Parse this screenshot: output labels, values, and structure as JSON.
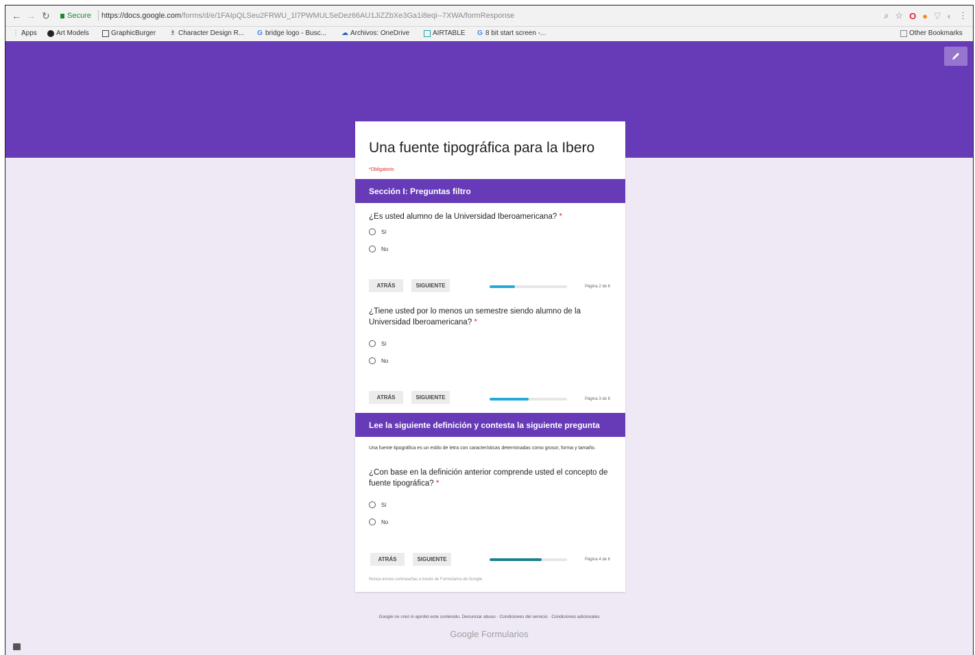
{
  "browser": {
    "secure_label": "Secure",
    "url_host": "https://docs.google.com",
    "url_path": "/forms/d/e/1FAIpQLSeu2FRWU_1l7PWMULSeDez66AU1JiZZbXe3Ga1i8eqi--7XWA/formResponse",
    "bookmarks": [
      "Apps",
      "Art Models",
      "GraphicBurger",
      "Character Design R...",
      "bridge logo - Busc...",
      "Archivos: OneDrive",
      "AIRTABLE",
      "8 bit start screen -...",
      "Other Bookmarks"
    ]
  },
  "form": {
    "title": "Una fuente tipográfica para la Ibero",
    "required_note": "*Obligatorio",
    "sections": [
      {
        "header": "Sección I: Preguntas filtro",
        "question": "¿Es usted alumno de la Universidad Iberoamericana?",
        "options": [
          "Sí",
          "No"
        ],
        "back": "ATRÁS",
        "next": "SIGUIENTE",
        "progress": 0.33,
        "page_text": "Página 2 de 6"
      },
      {
        "question": "¿Tiene usted por lo menos un semestre siendo alumno de la Universidad Iberoamericana?",
        "options": [
          "Sí",
          "No"
        ],
        "back": "ATRÁS",
        "next": "SIGUIENTE",
        "progress": 0.5,
        "page_text": "Página 3 de 6"
      },
      {
        "header": "Lee la siguiente definición y contesta la siguiente pregunta",
        "description": "Una fuente tipográfica es un estilo de letra con características determinadas como grosor, forma y tamaño.",
        "question": "¿Con base en la definición anterior comprende usted el concepto de fuente tipográfica?",
        "options": [
          "Sí",
          "No"
        ],
        "back": "ATRÁS",
        "next": "SIGUIENTE",
        "progress": 0.67,
        "page_text": "Página 4 de 6",
        "never_submit": "Nunca envíes contraseñas a través de Formularios de Google."
      }
    ],
    "footer_links": "Google no creó ni aprobó este contenido. Denunciar abuso · Condiciones del servicio · Condiciones adicionales",
    "brand": "Google Formularios"
  },
  "colors": {
    "theme": "#673ab7",
    "progress_fill": "#26a8d8",
    "progress_fill_last": "#1a8090",
    "required": "#d93025"
  }
}
